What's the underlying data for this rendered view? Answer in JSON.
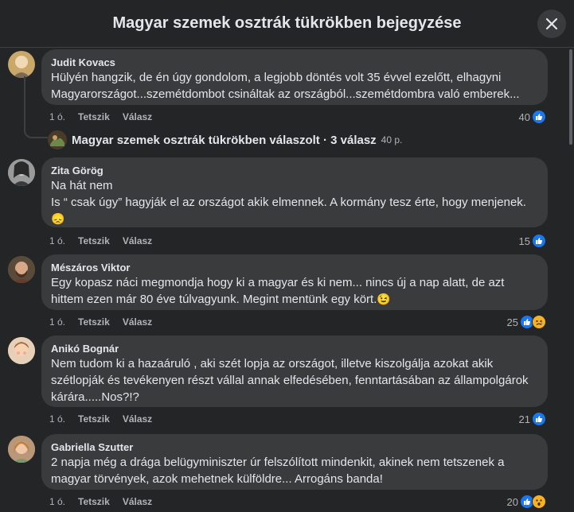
{
  "header": {
    "title": "Magyar szemek osztrák tükrökben bejegyzése"
  },
  "comments": [
    {
      "author": "Judit Kovacs",
      "text": "Hülyén hangzik, de én úgy gondolom, a legjobb döntés volt 35 évvel ezelőtt, elhagyni\nMagyarországot...szemétdombot csináltak az országból...szemétdombra való emberek...",
      "time": "1 ó.",
      "like": "Tetszik",
      "reply": "Válasz",
      "count": "40",
      "avatar_color": "#c9a86a"
    },
    {
      "author": "Zita Görög",
      "text": "Na hát nem\nIs “ csak úgy” hagyják el az országot akik elmennek. A kormány tesz érte, hogy menjenek.",
      "emoji": "😞",
      "time": "1 ó.",
      "like": "Tetszik",
      "reply": "Válasz",
      "count": "15",
      "avatar_color": "#8a8a8a"
    },
    {
      "author": "Mészáros Viktor",
      "text": "Egy kopasz náci megmondja hogy ki a magyar és ki nem... nincs új a nap alatt, de azt\nhittem ezen már 80 éve túlvagyunk. Megint mentünk egy kört.",
      "emoji": "😉",
      "time": "1 ó.",
      "like": "Tetszik",
      "reply": "Válasz",
      "count": "25",
      "avatar_color": "#7a5a40"
    },
    {
      "author": "Anikó Bognár",
      "text": "Nem tudom ki a hazaáruló , aki szét lopja az országot, illetve kiszolgálja azokat akik\nszétlopják és tevékenyen részt vállal annak elfedésében, fenntartásában az állampolgárok\nkárára.....Nos?!?",
      "time": "1 ó.",
      "like": "Tetszik",
      "reply": "Válasz",
      "count": "21",
      "avatar_color": "#d9b79a"
    },
    {
      "author": "Gabriella Szutter",
      "text": "2 napja még a drága belügyminiszter úr felszólított mindenkit, akinek nem tetszenek a\nmagyar törvények, azok mehetnek külföldre... Arrogáns banda!",
      "time": "1 ó.",
      "like": "Tetszik",
      "reply": "Válasz",
      "count": "20",
      "avatar_color": "#c4956e"
    }
  ],
  "replied": {
    "text": "Magyar szemek osztrák tükrökben válaszolt · 3 válasz",
    "time": "40 p."
  },
  "colors": {
    "like": "#1877f2",
    "sad": "#f7b125",
    "bubble": "#3a3b3c",
    "bg": "#242526"
  }
}
